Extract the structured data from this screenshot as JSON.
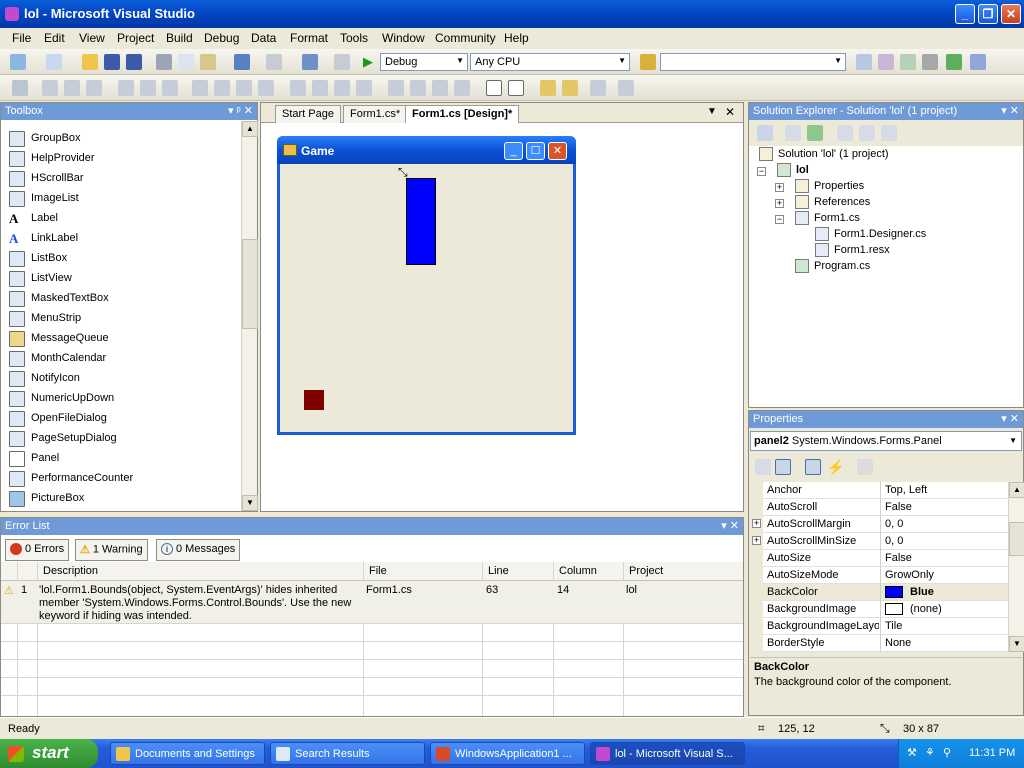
{
  "window": {
    "title": "lol - Microsoft Visual Studio"
  },
  "menu": [
    "File",
    "Edit",
    "View",
    "Project",
    "Build",
    "Debug",
    "Data",
    "Format",
    "Tools",
    "Window",
    "Community",
    "Help"
  ],
  "toolbar": {
    "config": "Debug",
    "platform": "Any CPU",
    "find_value": ""
  },
  "toolbox": {
    "title": "Toolbox",
    "items": [
      {
        "label": "GroupBox",
        "icon": "groupbox-icon"
      },
      {
        "label": "HelpProvider",
        "icon": "helpprovider-icon"
      },
      {
        "label": "HScrollBar",
        "icon": "hscrollbar-icon"
      },
      {
        "label": "ImageList",
        "icon": "imagelist-icon"
      },
      {
        "label": "Label",
        "icon": "label-icon"
      },
      {
        "label": "LinkLabel",
        "icon": "linklabel-icon"
      },
      {
        "label": "ListBox",
        "icon": "listbox-icon"
      },
      {
        "label": "ListView",
        "icon": "listview-icon"
      },
      {
        "label": "MaskedTextBox",
        "icon": "maskedtextbox-icon"
      },
      {
        "label": "MenuStrip",
        "icon": "menustrip-icon"
      },
      {
        "label": "MessageQueue",
        "icon": "messagequeue-icon"
      },
      {
        "label": "MonthCalendar",
        "icon": "monthcalendar-icon"
      },
      {
        "label": "NotifyIcon",
        "icon": "notifyicon-icon"
      },
      {
        "label": "NumericUpDown",
        "icon": "numericupdown-icon"
      },
      {
        "label": "OpenFileDialog",
        "icon": "openfiledialog-icon"
      },
      {
        "label": "PageSetupDialog",
        "icon": "pagesetupdialog-icon"
      },
      {
        "label": "Panel",
        "icon": "panel-icon"
      },
      {
        "label": "PerformanceCounter",
        "icon": "performancecounter-icon"
      },
      {
        "label": "PictureBox",
        "icon": "picturebox-icon"
      }
    ]
  },
  "tabs": [
    {
      "label": "Start Page"
    },
    {
      "label": "Form1.cs*"
    },
    {
      "label": "Form1.cs [Design]*"
    }
  ],
  "form": {
    "title": "Game",
    "panel_color": "#0000ff",
    "block_color": "#800000"
  },
  "solution": {
    "title": "Solution Explorer - Solution 'lol' (1 project)",
    "items": [
      {
        "label": "Solution 'lol' (1 project)"
      },
      {
        "label": "lol"
      },
      {
        "label": "Properties"
      },
      {
        "label": "References"
      },
      {
        "label": "Form1.cs"
      },
      {
        "label": "Form1.Designer.cs"
      },
      {
        "label": "Form1.resx"
      },
      {
        "label": "Program.cs"
      }
    ]
  },
  "properties": {
    "title": "Properties",
    "object_name": "panel2",
    "object_type": "System.Windows.Forms.Panel",
    "rows": [
      {
        "name": "Anchor",
        "value": "Top, Left"
      },
      {
        "name": "AutoScroll",
        "value": "False"
      },
      {
        "name": "AutoScrollMargin",
        "value": "0, 0"
      },
      {
        "name": "AutoScrollMinSize",
        "value": "0, 0"
      },
      {
        "name": "AutoSize",
        "value": "False"
      },
      {
        "name": "AutoSizeMode",
        "value": "GrowOnly"
      },
      {
        "name": "BackColor",
        "value": "Blue"
      },
      {
        "name": "BackgroundImage",
        "value": "(none)"
      },
      {
        "name": "BackgroundImageLayout",
        "value": "Tile"
      },
      {
        "name": "BorderStyle",
        "value": "None"
      }
    ],
    "desc_title": "BackColor",
    "desc_text": "The background color of the component."
  },
  "errorlist": {
    "title": "Error List",
    "errors_btn": "0 Errors",
    "warnings_btn": "1 Warning",
    "messages_btn": "0 Messages",
    "columns": [
      "Description",
      "File",
      "Line",
      "Column",
      "Project"
    ],
    "rows": [
      {
        "index": "1",
        "description": "'lol.Form1.Bounds(object, System.EventArgs)' hides inherited member 'System.Windows.Forms.Control.Bounds'. Use the new keyword if hiding was intended.",
        "file": "Form1.cs",
        "line": "63",
        "column": "14",
        "project": "lol"
      }
    ]
  },
  "status": {
    "text": "Ready",
    "position": "125, 12",
    "size": "30 x 87"
  },
  "taskbar": {
    "start": "start",
    "tasks": [
      {
        "label": "Documents and Settings"
      },
      {
        "label": "Search Results"
      },
      {
        "label": "WindowsApplication1 ..."
      },
      {
        "label": "lol - Microsoft Visual S..."
      }
    ],
    "time": "11:31 PM"
  }
}
